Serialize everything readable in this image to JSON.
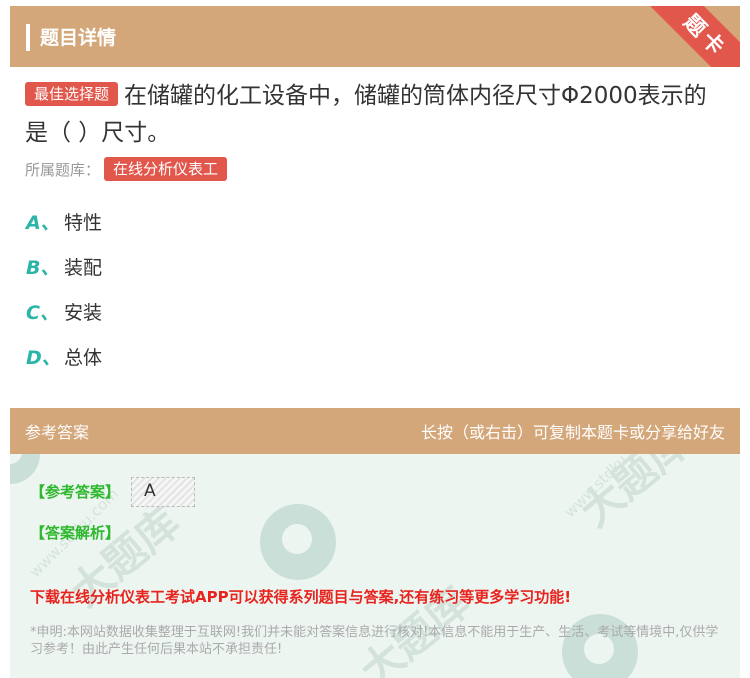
{
  "header": {
    "title": "题目详情",
    "corner_label": "题卡"
  },
  "question": {
    "type_badge": "最佳选择题",
    "text": "在储罐的化工设备中，储罐的筒体内径尺寸Φ2000表示的是（ ）尺寸。",
    "bank_label": "所属题库：",
    "bank_name": "在线分析仪表工"
  },
  "options": [
    {
      "letter": "A、",
      "text": "特性"
    },
    {
      "letter": "B、",
      "text": "装配"
    },
    {
      "letter": "C、",
      "text": "安装"
    },
    {
      "letter": "D、",
      "text": "总体"
    }
  ],
  "answer_section": {
    "title": "参考答案",
    "hint": "长按（或右击）可复制本题卡或分享给好友",
    "answer_label": "【参考答案】",
    "answer_value": "A",
    "analysis_label": "【答案解析】",
    "download_text": "下载在线分析仪表工考试APP可以获得系列题目与答案,还有练习等更多学习功能!",
    "disclaimer": "*申明:本网站数据收集整理于互联网!我们并未能对答案信息进行核对!本信息不能用于生产、生活、考试等情境中,仅供学习参考！由此产生任何后果本站不承担责任!"
  },
  "watermark": {
    "brand": "大题库",
    "url": "www.stdku.com"
  },
  "colors": {
    "header_bg": "#d4a77a",
    "accent_red": "#e2574c",
    "option_teal": "#2bb5a8",
    "answer_green": "#2eb82e",
    "panel_bg": "#edf5f1"
  }
}
